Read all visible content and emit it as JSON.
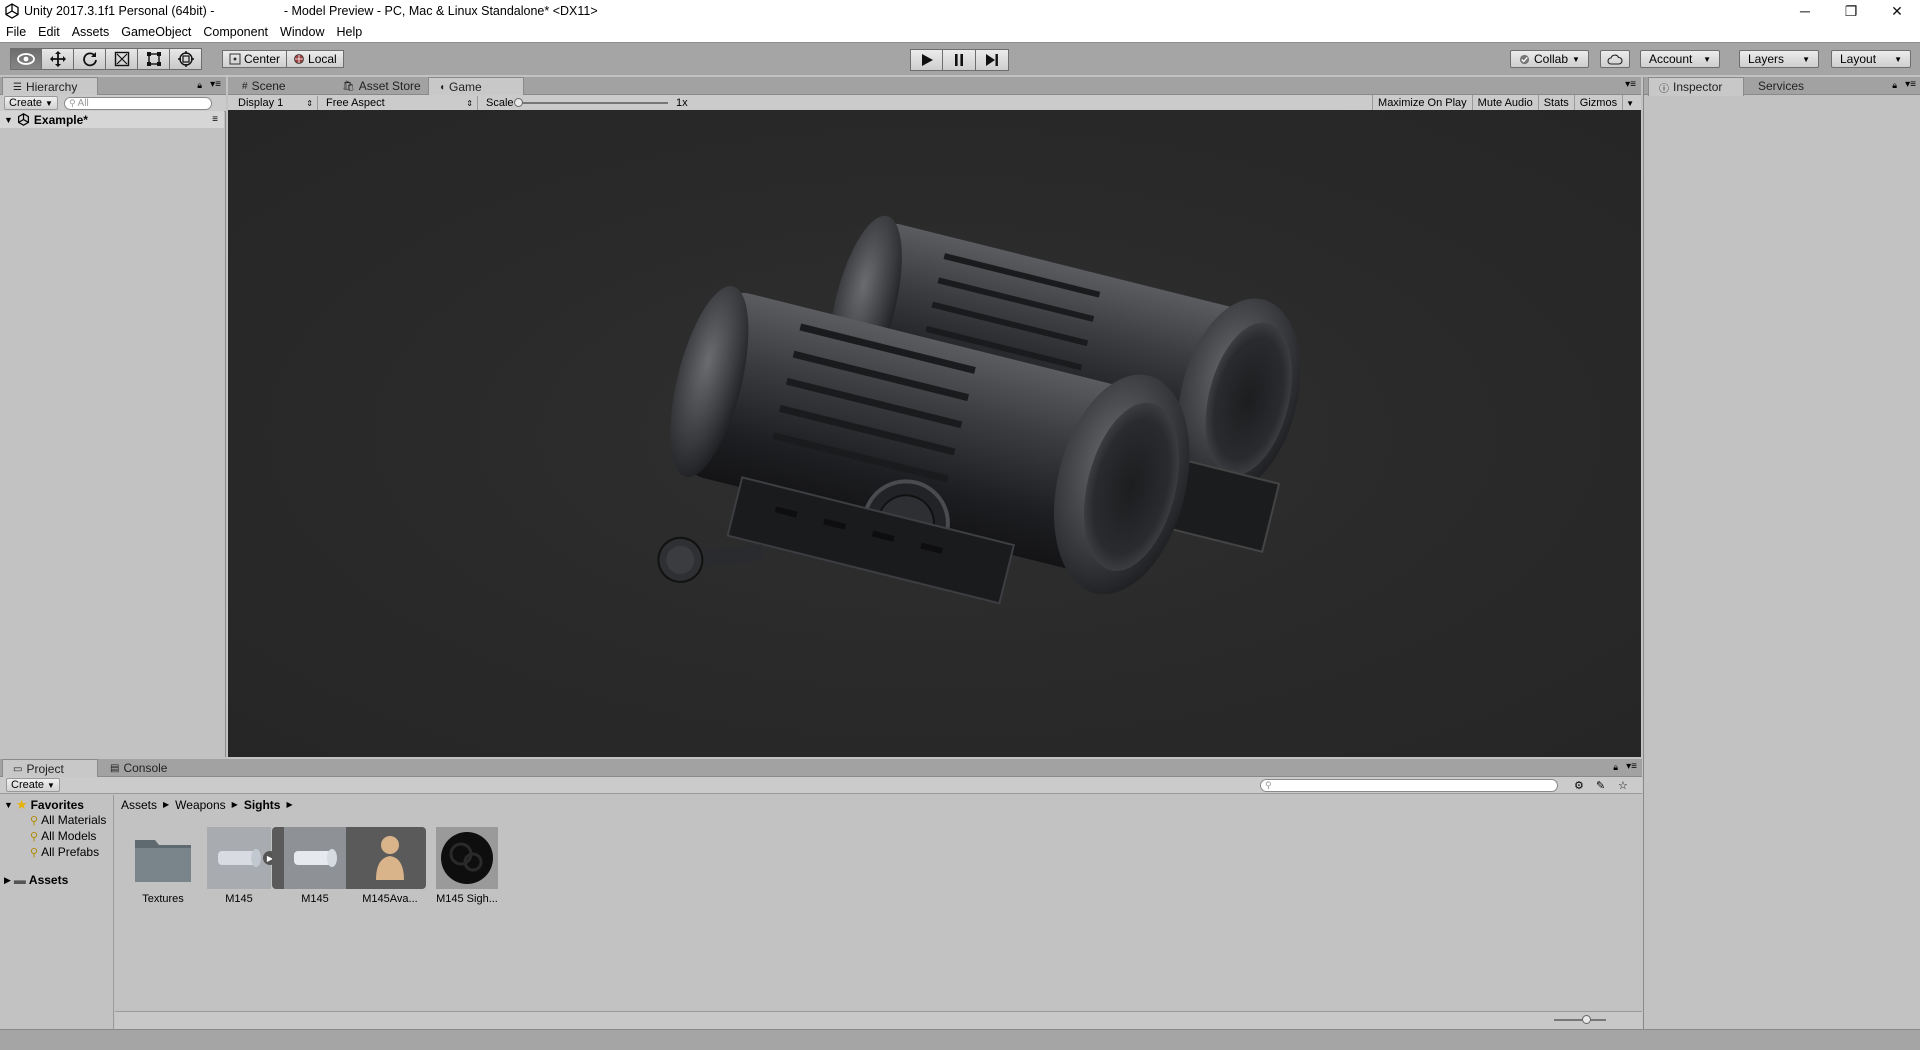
{
  "window": {
    "title": "Unity 2017.3.1f1 Personal (64bit) -                    - Model Preview - PC, Mac & Linux Standalone* <DX11>",
    "minimize": "─",
    "restore": "❐",
    "close": "✕"
  },
  "menu": [
    "File",
    "Edit",
    "Assets",
    "GameObject",
    "Component",
    "Window",
    "Help"
  ],
  "toolbar": {
    "tools": [
      "view-tool",
      "move-tool",
      "rotate-tool",
      "scale-tool",
      "rect-tool",
      "transform-tool"
    ],
    "pivot_label": "Center",
    "space_label": "Local",
    "collab_label": "Collab",
    "account_label": "Account",
    "layers_label": "Layers",
    "layout_label": "Layout"
  },
  "hierarchy": {
    "tab_label": "Hierarchy",
    "create_label": "Create",
    "search_placeholder": "All",
    "scene_name": "Example*"
  },
  "center_tabs": {
    "scene": "Scene",
    "asset_store": "Asset Store",
    "game": "Game"
  },
  "game_toolbar": {
    "display": "Display 1",
    "aspect": "Free Aspect",
    "scale_label": "Scale",
    "scale_value": "1x",
    "maximize": "Maximize On Play",
    "mute": "Mute Audio",
    "stats": "Stats",
    "gizmos": "Gizmos"
  },
  "inspector": {
    "tab_label": "Inspector",
    "services_label": "Services"
  },
  "project": {
    "tab_label": "Project",
    "console_label": "Console",
    "create_label": "Create",
    "favorites_label": "Favorites",
    "favorites": [
      "All Materials",
      "All Models",
      "All Prefabs"
    ],
    "assets_label": "Assets",
    "breadcrumb": [
      "Assets",
      "Weapons",
      "Sights"
    ],
    "items": [
      {
        "label": "Textures",
        "kind": "folder"
      },
      {
        "label": "M145",
        "kind": "model"
      },
      {
        "label": "M145",
        "kind": "mesh"
      },
      {
        "label": "M145Ava...",
        "kind": "avatar"
      },
      {
        "label": "M145 Sigh...",
        "kind": "material"
      }
    ]
  },
  "colors": {
    "game_bg": "#2a2a2a",
    "panel_bg": "#c2c2c2",
    "toolbar_bg": "#a5a5a5"
  }
}
